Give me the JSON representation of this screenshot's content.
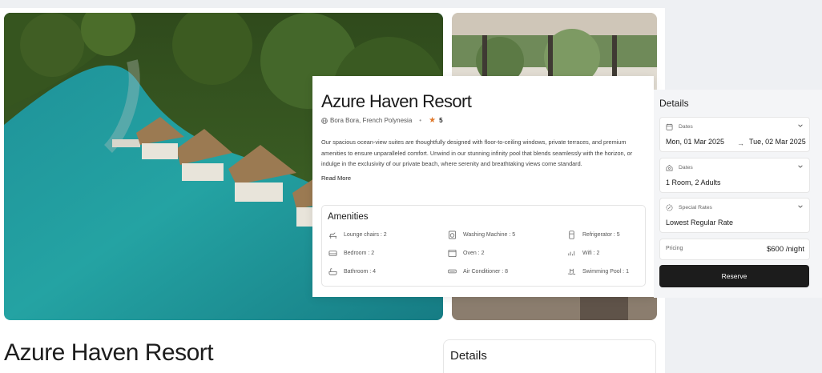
{
  "background": {
    "title": "Azure Haven Resort",
    "details_title": "Details"
  },
  "resort": {
    "title": "Azure Haven Resort",
    "location": "Bora Bora, French Polynesia",
    "rating": "5",
    "description": "Our spacious ocean-view suites are thoughtfully designed with floor-to-ceiling windows, private terraces, and premium amenities to ensure unparalleled comfort. Unwind in our stunning infinity pool that blends seamlessly with the horizon, or indulge in the exclusivity of our private beach, where serenity and breathtaking views come standard.",
    "read_more": "Read More"
  },
  "amenities": {
    "title": "Amenities",
    "items": [
      {
        "label": "Lounge chairs : 2",
        "icon": "lounge-chair-icon"
      },
      {
        "label": "Washing Machine : 5",
        "icon": "washing-machine-icon"
      },
      {
        "label": "Refrigerator : 5",
        "icon": "refrigerator-icon"
      },
      {
        "label": "Bedroom : 2",
        "icon": "bed-icon"
      },
      {
        "label": "Oven : 2",
        "icon": "oven-icon"
      },
      {
        "label": "Wifi : 2",
        "icon": "wifi-icon"
      },
      {
        "label": "Bathroom : 4",
        "icon": "bathtub-icon"
      },
      {
        "label": "Air Conditioner : 8",
        "icon": "air-conditioner-icon"
      },
      {
        "label": "Swimming Pool : 1",
        "icon": "swimming-pool-icon"
      }
    ]
  },
  "details": {
    "title": "Details",
    "dates": {
      "label": "Dates",
      "checkin": "Mon, 01 Mar 2025",
      "checkout": "Tue, 02 Mar 2025",
      "arrow": "→"
    },
    "guests": {
      "label": "Dates",
      "value": "1 Room, 2 Adults"
    },
    "rates": {
      "label": "Special Rates",
      "value": "Lowest Regular Rate"
    },
    "pricing": {
      "label": "Pricing",
      "value": "$600 /night"
    },
    "reserve_label": "Reserve"
  }
}
